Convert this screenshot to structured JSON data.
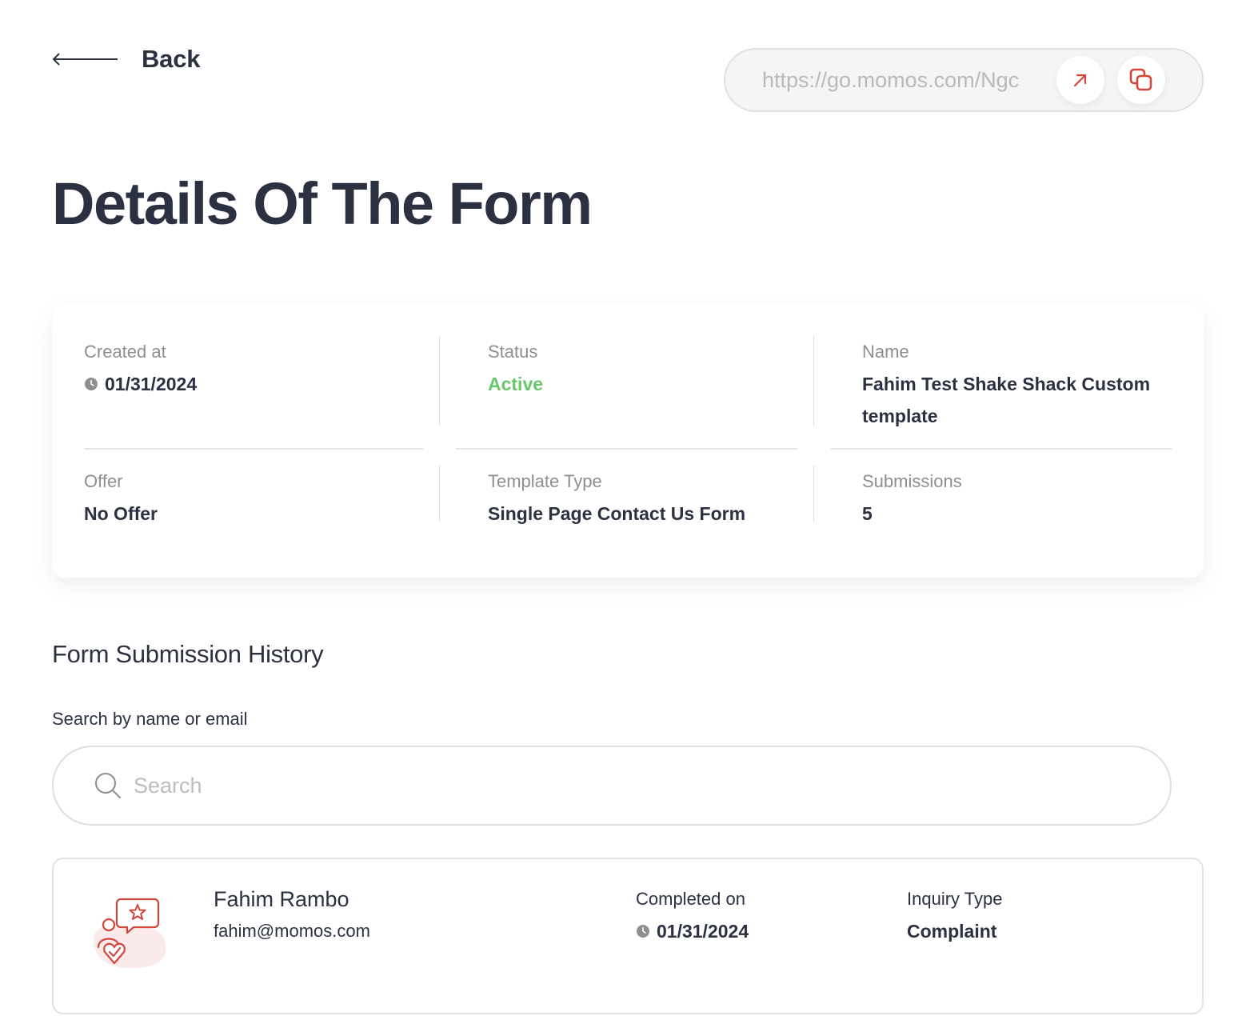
{
  "header": {
    "back_label": "Back",
    "url": "https://go.momos.com/Ngc",
    "open_link_icon": "arrow-up-right-icon",
    "copy_icon": "copy-icon"
  },
  "page": {
    "title": "Details Of The Form"
  },
  "details": {
    "created_at_label": "Created at",
    "created_at_value": "01/31/2024",
    "status_label": "Status",
    "status_value": "Active",
    "name_label": "Name",
    "name_value": "Fahim Test Shake Shack Custom template",
    "offer_label": "Offer",
    "offer_value": "No Offer",
    "template_type_label": "Template Type",
    "template_type_value": "Single Page Contact Us Form",
    "submissions_label": "Submissions",
    "submissions_value": "5"
  },
  "history": {
    "title": "Form Submission History",
    "search_label": "Search by name or email",
    "search_placeholder": "Search",
    "submissions": [
      {
        "name": "Fahim Rambo",
        "email": "fahim@momos.com",
        "completed_label": "Completed on",
        "completed_value": "01/31/2024",
        "inquiry_label": "Inquiry Type",
        "inquiry_value": "Complaint"
      }
    ]
  },
  "colors": {
    "text_primary": "#2c3142",
    "text_muted": "#8e8e8e",
    "status_active": "#67c76a",
    "accent_red": "#d2463c",
    "url_background": "#f5f5f5"
  }
}
